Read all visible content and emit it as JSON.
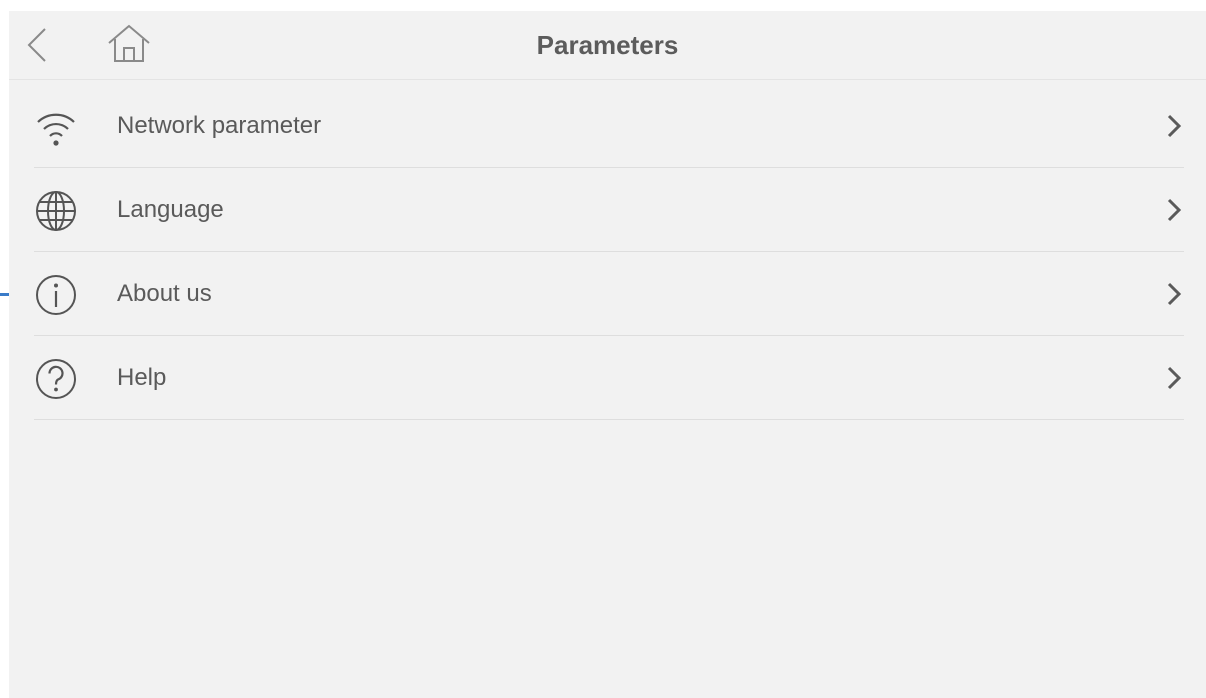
{
  "header": {
    "title": "Parameters",
    "back_icon": "chevron-left-icon",
    "home_icon": "home-icon"
  },
  "menu": {
    "items": [
      {
        "label": "Network parameter",
        "icon": "wifi-icon"
      },
      {
        "label": "Language",
        "icon": "globe-icon"
      },
      {
        "label": "About us",
        "icon": "info-icon"
      },
      {
        "label": "Help",
        "icon": "help-icon"
      }
    ]
  },
  "colors": {
    "background": "#f2f2f2",
    "text": "#5a5a5a",
    "icon": "#555555",
    "divider": "#dedede",
    "edge_accent": "#3a7bc8"
  }
}
